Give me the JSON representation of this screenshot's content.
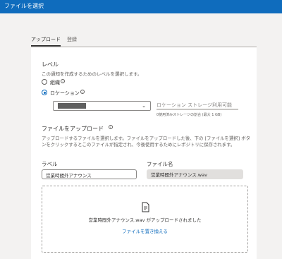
{
  "window": {
    "title": "ファイルを選択"
  },
  "tabs": [
    {
      "label": "アップロード"
    },
    {
      "label": "登録"
    }
  ],
  "level": {
    "heading": "レベル",
    "description": "この通知を作成するためのレベルを選択します。",
    "options": [
      {
        "label": "組織"
      },
      {
        "label": "ロケーション"
      }
    ],
    "selected_option": "ロケーション",
    "location_value": "K",
    "storage_label": "ロケーション ストレージ利用可能",
    "storage_note": "0使用済みストレージの割合 (最大 1 GB)"
  },
  "upload": {
    "heading": "ファイルをアップロード",
    "description": "アップロードするファイルを選択します。ファイルをアップロードした後、下の [ファイルを選択] ボタンをクリックするとこのファイルが指定され、今後使用するためにレポジトリに保存されます。",
    "label_field": {
      "label": "ラベル",
      "value": "営業時間外アナウンス"
    },
    "filename_field": {
      "label": "ファイル名",
      "value": "営業時間外アナウンス.wav"
    },
    "dropzone": {
      "message": "営業時間外アナウンス.wav がアップロードされました",
      "replace_link": "ファイルを置き換える"
    }
  },
  "icons": {
    "info": "info-icon",
    "chevron": "chevron-down-icon",
    "file": "document-icon"
  },
  "colors": {
    "accent": "#0f6cbd",
    "titlebar": "#0f6cbd"
  }
}
